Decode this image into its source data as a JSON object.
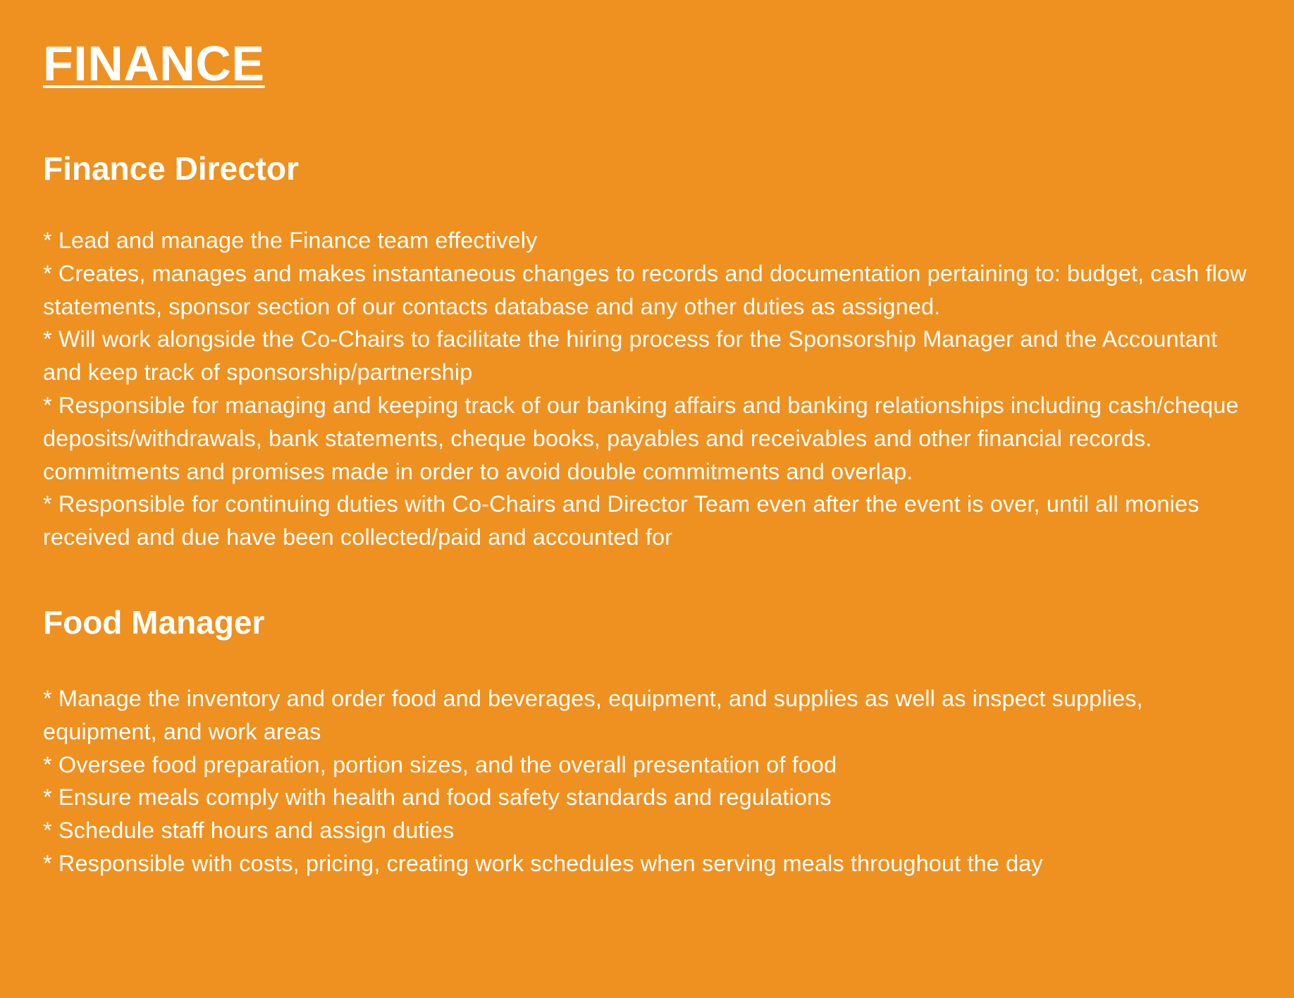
{
  "document": {
    "title": "FINANCE",
    "sections": [
      {
        "heading": "Finance Director",
        "items": [
          "* Lead and manage the Finance team effectively",
          "* Creates, manages and makes instantaneous changes to records and documentation pertaining to: budget, cash flow statements, sponsor section of our contacts database and any other duties as assigned.",
          "* Will work alongside the Co-Chairs to facilitate the hiring process for the Sponsorship Manager and the Accountant and keep track of sponsorship/partnership",
          "* Responsible for managing and keeping track of our banking affairs and banking relationships including cash/cheque deposits/withdrawals, bank statements, cheque books, payables and receivables and other financial records.",
          "commitments and promises made in order to avoid double commitments and overlap.",
          "* Responsible for continuing duties with Co-Chairs and Director Team even after the event is over, until all monies received and due have been collected/paid and accounted for"
        ]
      },
      {
        "heading": "Food Manager",
        "items": [
          "* Manage the inventory and order food and beverages, equipment, and supplies as well as inspect supplies, equipment, and work areas",
          "* Oversee food preparation, portion sizes, and the overall presentation of food",
          "* Ensure meals comply with health and food safety standards and regulations",
          "* Schedule staff hours and assign duties",
          "* Responsible with costs, pricing, creating work schedules when serving meals throughout the day"
        ]
      }
    ]
  },
  "colors": {
    "background": "#ee9120",
    "text": "#ffffff"
  }
}
